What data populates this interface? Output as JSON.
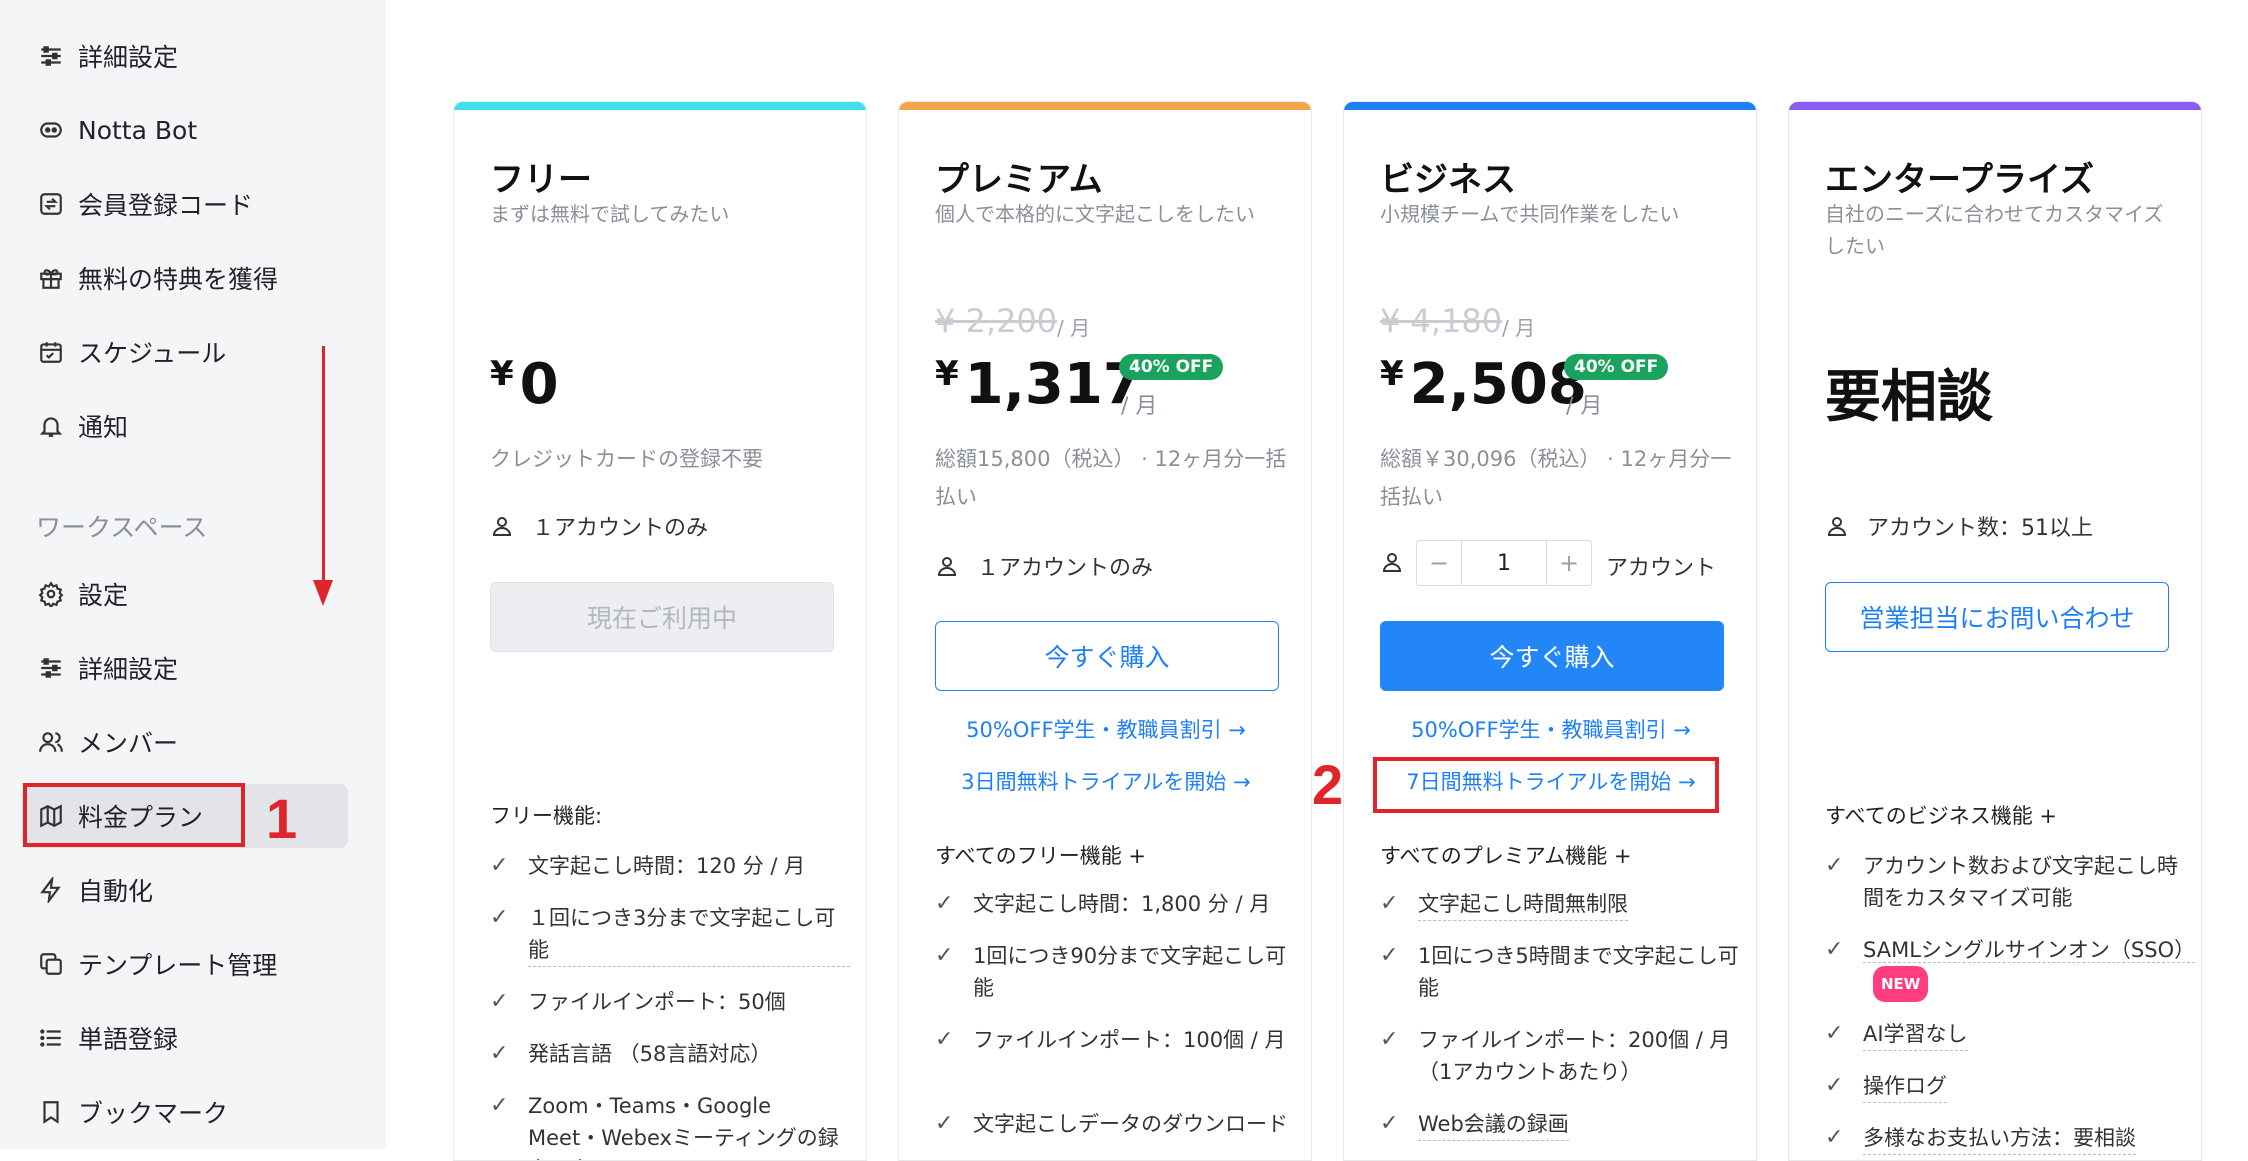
{
  "sidebar": {
    "items": [
      {
        "label": "詳細設定",
        "icon": "sliders-icon"
      },
      {
        "label": "Notta Bot",
        "icon": "bot-icon"
      },
      {
        "label": "会員登録コード",
        "icon": "code-icon"
      },
      {
        "label": "無料の特典を獲得",
        "icon": "gift-icon"
      },
      {
        "label": "スケジュール",
        "icon": "calendar-icon"
      },
      {
        "label": "通知",
        "icon": "bell-icon"
      }
    ],
    "workspace_label": "ワークスペース",
    "workspace_items": [
      {
        "label": "設定",
        "icon": "gear-icon"
      },
      {
        "label": "詳細設定",
        "icon": "sliders-icon"
      },
      {
        "label": "メンバー",
        "icon": "members-icon"
      },
      {
        "label": "料金プラン",
        "icon": "map-icon"
      },
      {
        "label": "自動化",
        "icon": "bolt-icon"
      },
      {
        "label": "テンプレート管理",
        "icon": "template-icon"
      },
      {
        "label": "単語登録",
        "icon": "list-icon"
      },
      {
        "label": "ブックマーク",
        "icon": "bookmark-icon"
      }
    ]
  },
  "annotations": {
    "one": "1",
    "two": "2",
    "color": "#e0242b"
  },
  "plans": {
    "free": {
      "color": "#3ee0ee",
      "title": "フリー",
      "subtitle": "まずは無料で試してみたい",
      "currency": "¥",
      "price": "0",
      "note": "クレジットカードの登録不要",
      "account": "１アカウントのみ",
      "button": "現在ご利用中",
      "features_head": "フリー機能:",
      "features": [
        "文字起こし時間：120 分 / 月",
        "１回につき3分まで文字起こし可能",
        "ファイルインポート：50個",
        "発話言語 （58言語対応）",
        "Zoom・Teams・Google Meet・Webexミーティングの録音・文"
      ]
    },
    "premium": {
      "color": "#f5a44a",
      "title": "プレミアム",
      "subtitle": "個人で本格的に文字起こしをしたい",
      "old_price": "¥ 2,200",
      "per_month_small": "/ 月",
      "currency": "¥",
      "price": "1,317",
      "per_month": "/ 月",
      "badge": "40% OFF",
      "note": "総額15,800（税込） · 12ヶ月分一括払い",
      "account": "１アカウントのみ",
      "button": "今すぐ購入",
      "link_student": "50%OFF学生・教職員割引 →",
      "link_trial": "3日間無料トライアルを開始 →",
      "features_head": "すべてのフリー機能 +",
      "features": [
        "文字起こし時間：1,800 分 / 月",
        "1回につき90分まで文字起こし可能",
        "ファイルインポート：100個 / 月",
        "文字起こしデータのダウンロード"
      ]
    },
    "business": {
      "color": "#1f7ff5",
      "title": "ビジネス",
      "subtitle": "小規模チームで共同作業をしたい",
      "old_price": "¥ 4,180",
      "per_month_small": "/ 月",
      "currency": "¥",
      "price": "2,508",
      "per_month": "/ 月",
      "badge": "40% OFF",
      "note": "総額￥30,096（税込） · 12ヶ月分一括払い",
      "stepper_minus": "−",
      "stepper_value": "1",
      "stepper_plus": "+",
      "account_label": "アカウント",
      "button": "今すぐ購入",
      "link_student": "50%OFF学生・教職員割引 →",
      "link_trial": "7日間無料トライアルを開始 →",
      "features_head": "すべてのプレミアム機能 +",
      "features": [
        "文字起こし時間無制限",
        "1回につき5時間まで文字起こし可能",
        "ファイルインポート：200個 / 月（1アカウントあたり）",
        "Web会議の録画"
      ]
    },
    "enterprise": {
      "color": "#8a5cf0",
      "title": "エンタープライズ",
      "subtitle": "自社のニーズに合わせてカスタマイズしたい",
      "price": "要相談",
      "account": "アカウント数：51以上",
      "button": "営業担当にお問い合わせ",
      "features_head": "すべてのビジネス機能 +",
      "features": [
        "アカウント数および文字起こし時間をカスタマイズ可能",
        "SAMLシングルサインオン（SSO）",
        "AI学習なし",
        "操作ログ",
        "多様なお支払い方法：要相談"
      ],
      "new_badge": "NEW"
    }
  }
}
